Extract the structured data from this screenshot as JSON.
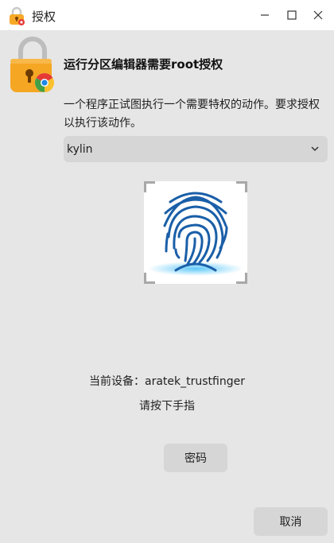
{
  "window": {
    "title": "授权",
    "icons": {
      "app": "lock-icon",
      "minimize": "minimize-icon",
      "maximize": "maximize-icon",
      "close": "close-icon"
    }
  },
  "dialog": {
    "headline": "运行分区编辑器需要root授权",
    "description": "一个程序正试图执行一个需要特权的动作。要求授权以执行该动作。",
    "user_select": {
      "value": "kylin",
      "icon": "chevron-down-icon"
    },
    "fingerprint": {
      "icon": "fingerprint-icon"
    },
    "device_label": "当前设备：aratek_trustfinger",
    "prompt": "请按下手指",
    "password_button": "密码",
    "cancel_button": "取消"
  },
  "colors": {
    "accent_orange": "#f5a623",
    "fingerprint_blue": "#1a5fa8",
    "background": "#e6e6e6"
  }
}
